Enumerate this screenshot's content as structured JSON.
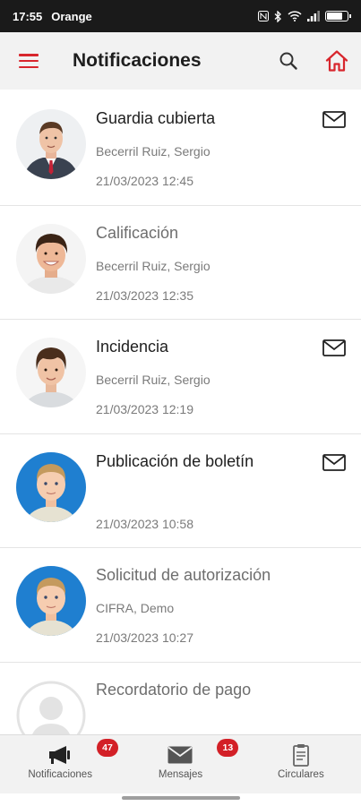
{
  "status_bar": {
    "time": "17:55",
    "carrier": "Orange",
    "battery_level": 0.8
  },
  "header": {
    "title": "Notificaciones",
    "menu_icon": "menu-icon",
    "search_icon": "search-icon",
    "home_icon": "home-icon",
    "accent_color": "#d8262d"
  },
  "notifications": [
    {
      "subject": "Guardia cubierta",
      "sender": "Becerril Ruiz, Sergio",
      "date": "21/03/2023 12:45",
      "unread": true,
      "avatar": "man-in-suit"
    },
    {
      "subject": "Calificación",
      "sender": "Becerril Ruiz, Sergio",
      "date": "21/03/2023 12:35",
      "unread": false,
      "avatar": "smiling-man"
    },
    {
      "subject": "Incidencia",
      "sender": "Becerril Ruiz, Sergio",
      "date": "21/03/2023 12:19",
      "unread": true,
      "avatar": "child-boy"
    },
    {
      "subject": "Publicación de boletín",
      "sender": "",
      "date": "21/03/2023 10:58",
      "unread": true,
      "avatar": "toddler-blue"
    },
    {
      "subject": "Solicitud de autorización",
      "sender": "CIFRA, Demo",
      "date": "21/03/2023 10:27",
      "unread": false,
      "avatar": "toddler-blue"
    },
    {
      "subject": "Recordatorio de pago",
      "sender": "",
      "date": "",
      "unread": false,
      "avatar": "placeholder-person"
    }
  ],
  "bottom_nav": {
    "tabs": [
      {
        "label": "Notificaciones",
        "badge": "47",
        "icon": "megaphone-icon"
      },
      {
        "label": "Mensajes",
        "badge": "13",
        "icon": "envelope-icon"
      },
      {
        "label": "Circulares",
        "badge": "",
        "icon": "clipboard-icon"
      }
    ],
    "badge_color": "#d32027"
  }
}
